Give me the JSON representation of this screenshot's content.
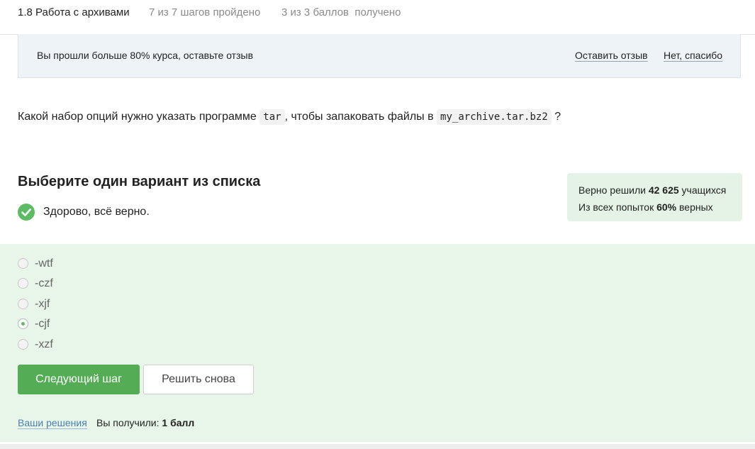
{
  "header": {
    "lesson_title": "1.8 Работа с архивами",
    "steps_progress": "7 из 7 шагов пройдено",
    "points_progress": "3 из 3 баллов  получено"
  },
  "banner": {
    "text": "Вы прошли больше 80% курса, оставьте отзыв",
    "leave_review": "Оставить отзыв",
    "no_thanks": "Нет, спасибо"
  },
  "question": {
    "text_before": "Какой набор опций нужно указать программе",
    "code1": "tar",
    "text_middle": ", чтобы запаковать файлы в",
    "code2": "my_archive.tar.bz2",
    "text_after": "?"
  },
  "quiz": {
    "heading": "Выберите один вариант из списка",
    "feedback": "Здорово, всё верно.",
    "options": [
      {
        "label": "-wtf",
        "checked": false
      },
      {
        "label": "-czf",
        "checked": false
      },
      {
        "label": "-xjf",
        "checked": false
      },
      {
        "label": "-cjf",
        "checked": true
      },
      {
        "label": "-xzf",
        "checked": false
      }
    ],
    "next_button": "Следующий шаг",
    "retry_button": "Решить снова"
  },
  "stats": {
    "solved_prefix": "Верно решили",
    "solved_count": "42 625",
    "solved_suffix": "учащихся",
    "attempts_prefix": "Из всех попыток",
    "attempts_percent": "60%",
    "attempts_suffix": "верных"
  },
  "footer": {
    "solutions_link": "Ваши решения",
    "score_prefix": "Вы получили:",
    "score_value": "1 балл"
  },
  "colors": {
    "accent_green": "#54ad54",
    "success_bg": "#e8f5e9",
    "link_blue": "#4a7fb5"
  }
}
